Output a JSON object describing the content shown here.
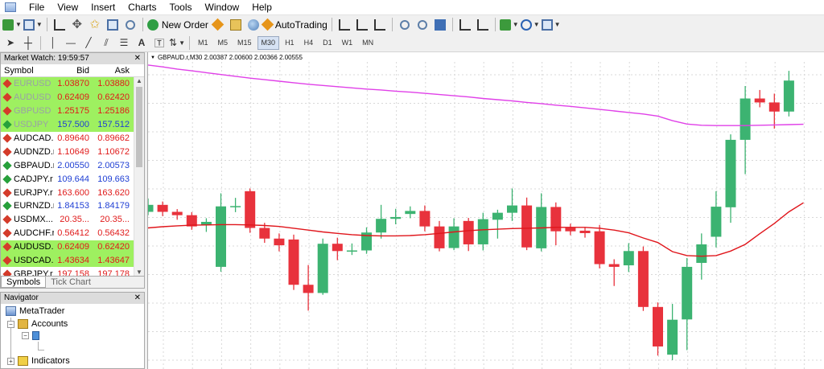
{
  "menu": [
    "File",
    "View",
    "Insert",
    "Charts",
    "Tools",
    "Window",
    "Help"
  ],
  "toolbar": {
    "new_order": "New Order",
    "auto_trading": "AutoTrading"
  },
  "timeframes": [
    "M1",
    "M5",
    "M15",
    "M30",
    "H1",
    "H4",
    "D1",
    "W1",
    "MN"
  ],
  "active_timeframe": "M30",
  "market_watch": {
    "title": "Market Watch: 19:59:57",
    "columns": {
      "symbol": "Symbol",
      "bid": "Bid",
      "ask": "Ask"
    },
    "rows": [
      {
        "symbol": "EURUSD",
        "bid": "1.03870",
        "ask": "1.03880",
        "dir": "down",
        "hl": true,
        "muted": true,
        "color": "red"
      },
      {
        "symbol": "AUDUSD",
        "bid": "0.62409",
        "ask": "0.62420",
        "dir": "down",
        "hl": true,
        "muted": true,
        "color": "red"
      },
      {
        "symbol": "GBPUSD",
        "bid": "1.25175",
        "ask": "1.25186",
        "dir": "down",
        "hl": true,
        "muted": true,
        "color": "red"
      },
      {
        "symbol": "USDJPY",
        "bid": "157.500",
        "ask": "157.512",
        "dir": "up",
        "hl": true,
        "muted": true,
        "color": "blue"
      },
      {
        "symbol": "AUDCAD.r",
        "bid": "0.89640",
        "ask": "0.89662",
        "dir": "down",
        "hl": false,
        "muted": false,
        "color": "red"
      },
      {
        "symbol": "AUDNZD.r",
        "bid": "1.10649",
        "ask": "1.10672",
        "dir": "down",
        "hl": false,
        "muted": false,
        "color": "red"
      },
      {
        "symbol": "GBPAUD.r",
        "bid": "2.00550",
        "ask": "2.00573",
        "dir": "up",
        "hl": false,
        "muted": false,
        "color": "blue"
      },
      {
        "symbol": "CADJPY.r",
        "bid": "109.644",
        "ask": "109.663",
        "dir": "up",
        "hl": false,
        "muted": false,
        "color": "blue"
      },
      {
        "symbol": "EURJPY.r",
        "bid": "163.600",
        "ask": "163.620",
        "dir": "down",
        "hl": false,
        "muted": false,
        "color": "red"
      },
      {
        "symbol": "EURNZD.r",
        "bid": "1.84153",
        "ask": "1.84179",
        "dir": "up",
        "hl": false,
        "muted": false,
        "color": "blue"
      },
      {
        "symbol": "USDMX...",
        "bid": "20.35...",
        "ask": "20.35...",
        "dir": "down",
        "hl": false,
        "muted": false,
        "color": "red"
      },
      {
        "symbol": "AUDCHF.r",
        "bid": "0.56412",
        "ask": "0.56432",
        "dir": "down",
        "hl": false,
        "muted": false,
        "color": "red"
      },
      {
        "symbol": "AUDUSD.r",
        "bid": "0.62409",
        "ask": "0.62420",
        "dir": "down",
        "hl": true,
        "muted": false,
        "color": "red"
      },
      {
        "symbol": "USDCAD.r",
        "bid": "1.43634",
        "ask": "1.43647",
        "dir": "down",
        "hl": true,
        "muted": false,
        "color": "red"
      },
      {
        "symbol": "GBPJPY.r",
        "bid": "197.158",
        "ask": "197.178",
        "dir": "down",
        "hl": false,
        "muted": false,
        "color": "red"
      }
    ],
    "tabs": [
      "Symbols",
      "Tick Chart"
    ]
  },
  "navigator": {
    "title": "Navigator",
    "items": {
      "root": "MetaTrader",
      "accounts": "Accounts",
      "indicators": "Indicators"
    }
  },
  "chart": {
    "title": "GBPAUD.r,M30  2.00387 2.00600 2.00366 2.00555",
    "colors": {
      "bull": "#3cb371",
      "bear": "#e8323c",
      "ma_fast": "#e0151b",
      "ma_slow": "#e040e8",
      "grid": "#d8d8d8"
    }
  },
  "chart_data": {
    "type": "candlestick",
    "title": "GBPAUD.r,M30  2.00387 2.00600 2.00366 2.00555",
    "price_scale": "unlabeled (relative units, 0 = bottom, 100 = top of plot)",
    "candles": [
      {
        "o": 49.6,
        "c": 51.9,
        "h": 54.0,
        "l": 48.5
      },
      {
        "o": 51.9,
        "c": 49.6,
        "h": 53.0,
        "l": 48.2
      },
      {
        "o": 49.6,
        "c": 48.5,
        "h": 50.5,
        "l": 47.0
      },
      {
        "o": 48.5,
        "c": 44.8,
        "h": 49.5,
        "l": 43.7
      },
      {
        "o": 45.2,
        "c": 46.3,
        "h": 47.5,
        "l": 43.0
      },
      {
        "o": 31.5,
        "c": 51.4,
        "h": 55.7,
        "l": 29.9
      },
      {
        "o": 51.5,
        "c": 51.5,
        "h": 54.2,
        "l": 49.5
      },
      {
        "o": 56.4,
        "c": 44.3,
        "h": 57.3,
        "l": 42.7
      },
      {
        "o": 44.3,
        "c": 40.8,
        "h": 46.0,
        "l": 39.4
      },
      {
        "o": 40.8,
        "c": 38.6,
        "h": 42.5,
        "l": 36.6
      },
      {
        "o": 40.5,
        "c": 25.6,
        "h": 42.1,
        "l": 23.9
      },
      {
        "o": 25.6,
        "c": 22.9,
        "h": 32.1,
        "l": 17.1
      },
      {
        "o": 22.9,
        "c": 39.1,
        "h": 40.8,
        "l": 22.3
      },
      {
        "o": 39.1,
        "c": 36.7,
        "h": 41.1,
        "l": 33.7
      },
      {
        "o": 36.6,
        "c": 36.9,
        "h": 39.2,
        "l": 35.4
      },
      {
        "o": 36.9,
        "c": 42.8,
        "h": 44.5,
        "l": 35.8
      },
      {
        "o": 42.8,
        "c": 47.3,
        "h": 51.9,
        "l": 40.8
      },
      {
        "o": 47.3,
        "c": 47.9,
        "h": 50.6,
        "l": 45.5
      },
      {
        "o": 48.9,
        "c": 49.9,
        "h": 51.4,
        "l": 47.5
      },
      {
        "o": 49.9,
        "c": 44.8,
        "h": 51.7,
        "l": 43.2
      },
      {
        "o": 44.8,
        "c": 37.6,
        "h": 46.6,
        "l": 36.6
      },
      {
        "o": 37.7,
        "c": 44.8,
        "h": 47.5,
        "l": 37.0
      },
      {
        "o": 46.6,
        "c": 38.9,
        "h": 47.6,
        "l": 36.7
      },
      {
        "o": 38.9,
        "c": 47.2,
        "h": 49.3,
        "l": 36.9
      },
      {
        "o": 47.0,
        "c": 49.3,
        "h": 50.3,
        "l": 40.8
      },
      {
        "o": 49.3,
        "c": 51.7,
        "h": 57.3,
        "l": 46.6
      },
      {
        "o": 51.7,
        "c": 37.9,
        "h": 54.3,
        "l": 37.0
      },
      {
        "o": 37.6,
        "c": 51.2,
        "h": 55.7,
        "l": 36.6
      },
      {
        "o": 51.2,
        "c": 43.2,
        "h": 52.7,
        "l": 38.6
      },
      {
        "o": 44.3,
        "c": 43.2,
        "h": 45.7,
        "l": 41.9
      },
      {
        "o": 43.4,
        "c": 42.6,
        "h": 44.4,
        "l": 41.1
      },
      {
        "o": 43.2,
        "c": 32.4,
        "h": 45.3,
        "l": 31.0
      },
      {
        "o": 32.4,
        "c": 31.5,
        "h": 34.0,
        "l": 25.2
      },
      {
        "o": 32.0,
        "c": 36.7,
        "h": 39.3,
        "l": 29.8
      },
      {
        "o": 36.7,
        "c": 18.3,
        "h": 38.2,
        "l": 17.0
      },
      {
        "o": 18.3,
        "c": 5.3,
        "h": 19.8,
        "l": 2.3
      },
      {
        "o": 2.6,
        "c": 14.1,
        "h": 19.3,
        "l": 0.8
      },
      {
        "o": 14.2,
        "c": 31.5,
        "h": 34.4,
        "l": 4.1
      },
      {
        "o": 32.8,
        "c": 38.9,
        "h": 42.5,
        "l": 27.3
      },
      {
        "o": 41.4,
        "c": 51.3,
        "h": 56.4,
        "l": 37.9
      },
      {
        "o": 51.1,
        "c": 73.3,
        "h": 75.1,
        "l": 46.0
      },
      {
        "o": 73.3,
        "c": 86.9,
        "h": 91.0,
        "l": 62.0
      },
      {
        "o": 86.9,
        "c": 85.6,
        "h": 89.7,
        "l": 84.0
      },
      {
        "o": 85.6,
        "c": 82.6,
        "h": 88.5,
        "l": 77.0
      },
      {
        "o": 82.6,
        "c": 92.8,
        "h": 96.0,
        "l": 81.0
      }
    ],
    "ma_fast": [
      44.3,
      44.7,
      45.0,
      45.2,
      45.3,
      45.4,
      45.4,
      45.3,
      45.1,
      44.8,
      44.2,
      43.6,
      43.0,
      42.5,
      42.1,
      41.8,
      41.7,
      41.7,
      41.8,
      42.1,
      42.5,
      43.0,
      43.4,
      43.7,
      43.9,
      44.1,
      44.2,
      44.3,
      44.5,
      44.5,
      44.5,
      44.2,
      43.6,
      42.7,
      41.0,
      39.5,
      36.5,
      35.2,
      35.0,
      35.2,
      36.7,
      38.9,
      42.4,
      45.8,
      49.6,
      52.6
    ],
    "ma_slow": [
      97.9,
      97.3,
      96.6,
      96.0,
      95.4,
      94.8,
      94.2,
      93.6,
      93.1,
      92.6,
      92.1,
      91.6,
      91.2,
      90.8,
      90.4,
      90.0,
      89.7,
      89.3,
      89.0,
      88.6,
      88.2,
      87.8,
      87.4,
      86.9,
      86.5,
      86.1,
      85.6,
      85.2,
      84.7,
      84.3,
      83.8,
      83.3,
      82.8,
      82.3,
      81.8,
      81.1,
      79.6,
      78.5,
      78.1,
      78.0,
      78.0,
      78.0,
      78.1,
      78.2,
      78.3,
      78.4
    ]
  }
}
